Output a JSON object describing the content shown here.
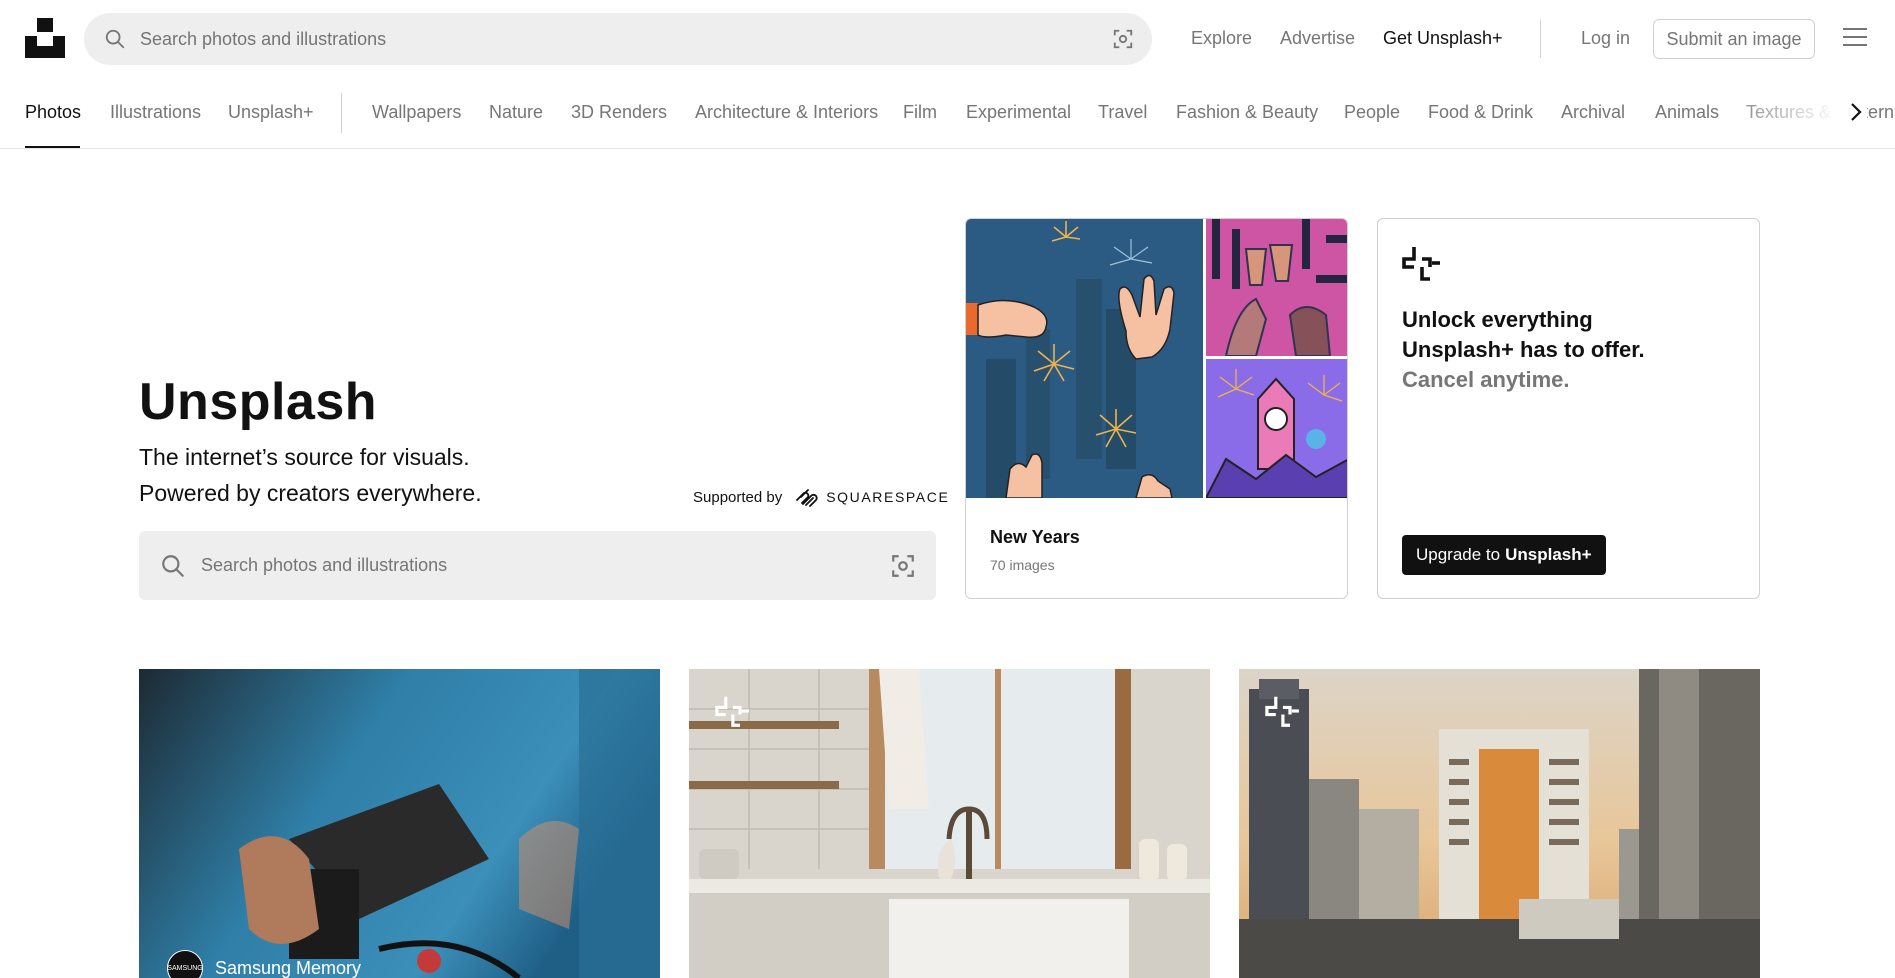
{
  "header": {
    "logo": "unsplash-logo",
    "search_placeholder": "Search photos and illustrations",
    "nav": {
      "explore": "Explore",
      "advertise": "Advertise",
      "get_plus": "Get Unsplash+",
      "login": "Log in",
      "submit": "Submit an image"
    }
  },
  "categories": {
    "primary": [
      "Photos",
      "Illustrations",
      "Unsplash+"
    ],
    "topics": [
      "Wallpapers",
      "Nature",
      "3D Renders",
      "Architecture & Interiors",
      "Film",
      "Experimental",
      "Travel",
      "Fashion & Beauty",
      "People",
      "Food & Drink",
      "Archival",
      "Animals",
      "Textures & Patterns"
    ],
    "active": "Photos"
  },
  "hero": {
    "title": "Unsplash",
    "subtitle_line1": "The internet’s source for visuals.",
    "subtitle_line2": "Powered by creators everywhere.",
    "supported_by": "Supported by",
    "sponsor": "SQUARESPACE",
    "search_placeholder": "Search photos and illustrations"
  },
  "collection_card": {
    "title": "New Years",
    "count": "70 images"
  },
  "plus_card": {
    "headline_line1": "Unlock everything",
    "headline_line2": "Unsplash+ has to offer.",
    "headline_muted": "Cancel anytime.",
    "button_prefix": "Upgrade to",
    "button_bold": "Unsplash+"
  },
  "photos": [
    {
      "credit": "Samsung Memory",
      "avatar_text": "SAMSUNG"
    },
    {
      "credit": ""
    },
    {
      "credit": ""
    }
  ],
  "colors": {
    "text": "#111111",
    "muted": "#767676",
    "search_bg": "#eeeeee",
    "border": "#d1d1d1"
  }
}
